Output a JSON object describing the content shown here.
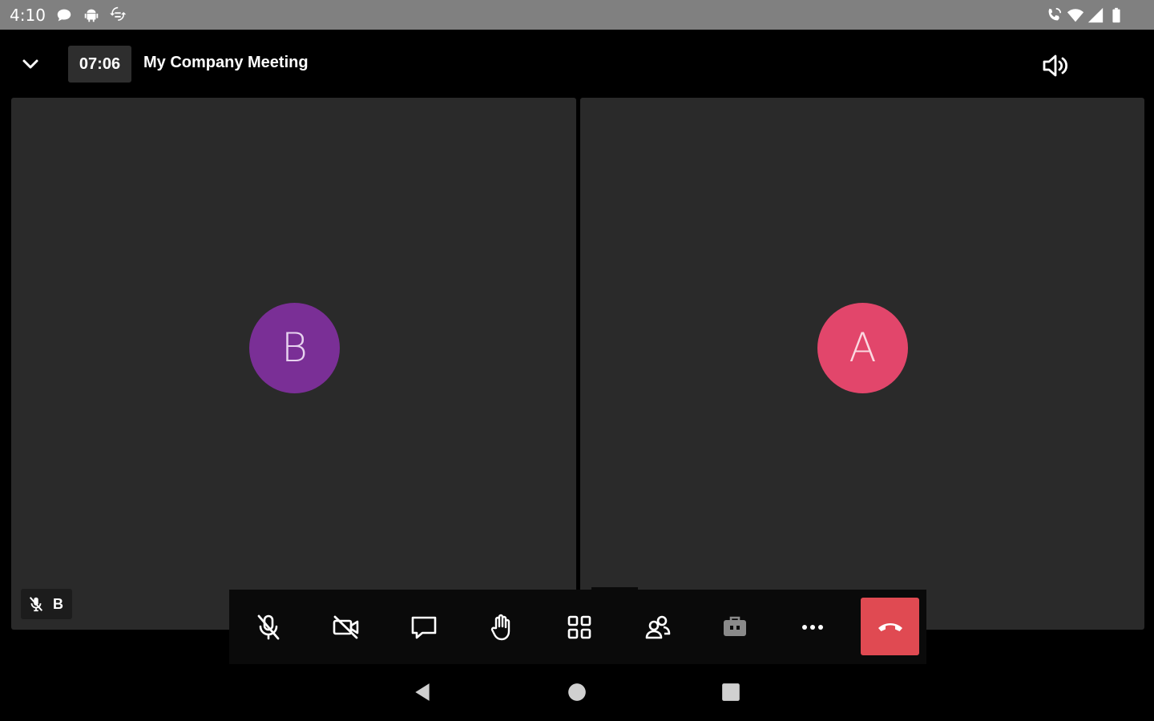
{
  "status_bar": {
    "time": "4:10",
    "left_icons": [
      "chat-bubble-icon",
      "android-icon",
      "sync-icon"
    ],
    "right_icons": [
      "wifi-call-icon",
      "wifi-icon",
      "signal-icon",
      "battery-icon"
    ]
  },
  "header": {
    "collapse_icon": "chevron-down-icon",
    "timer": "07:06",
    "title": "My Company Meeting",
    "speaker_icon": "speaker-icon"
  },
  "participants": [
    {
      "initial": "B",
      "color": "#7a2f96"
    },
    {
      "initial": "A",
      "color": "#e2466b"
    }
  ],
  "self_tag": {
    "label": "B",
    "icon": "mic-off-icon"
  },
  "toolbar": {
    "buttons": [
      "mic-off-icon",
      "video-off-icon",
      "chat-icon",
      "raise-hand-icon",
      "grid-view-icon",
      "participants-icon",
      "breakout-rooms-icon",
      "more-icon"
    ],
    "hangup_icon": "hang-up-icon",
    "hangup_color": "#e04a52"
  },
  "nav_bar": {
    "icons": [
      "back-icon",
      "home-icon",
      "recents-icon"
    ]
  }
}
